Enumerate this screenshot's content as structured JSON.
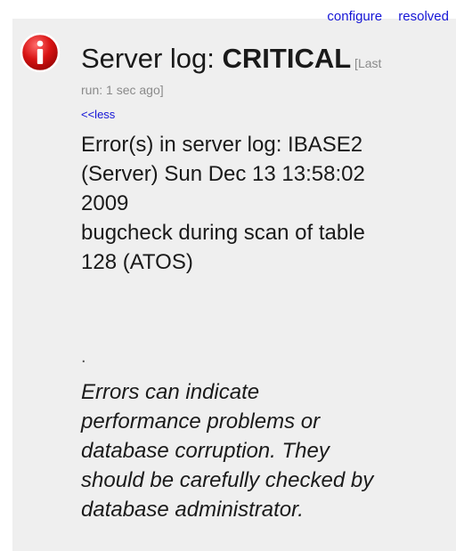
{
  "actions": {
    "configure_label": "configure",
    "resolved_label": "resolved"
  },
  "alert": {
    "icon": "info-icon",
    "icon_color": "#cc1111",
    "title_prefix": "Server log: ",
    "status": "CRITICAL",
    "last_run_part1": " [Last",
    "last_run_part2": "run: 1 sec ago]",
    "less_link": "<<less",
    "details_lines": [
      "Error(s) in server log: IBASE2",
      "(Server) Sun Dec 13 13:58:02",
      "2009",
      "bugcheck during scan of table",
      "128 (ATOS)"
    ],
    "separator": ".",
    "note_lines": [
      "Errors can indicate",
      "performance problems or",
      "database corruption. They",
      "should be carefully checked by",
      "database administrator."
    ]
  }
}
